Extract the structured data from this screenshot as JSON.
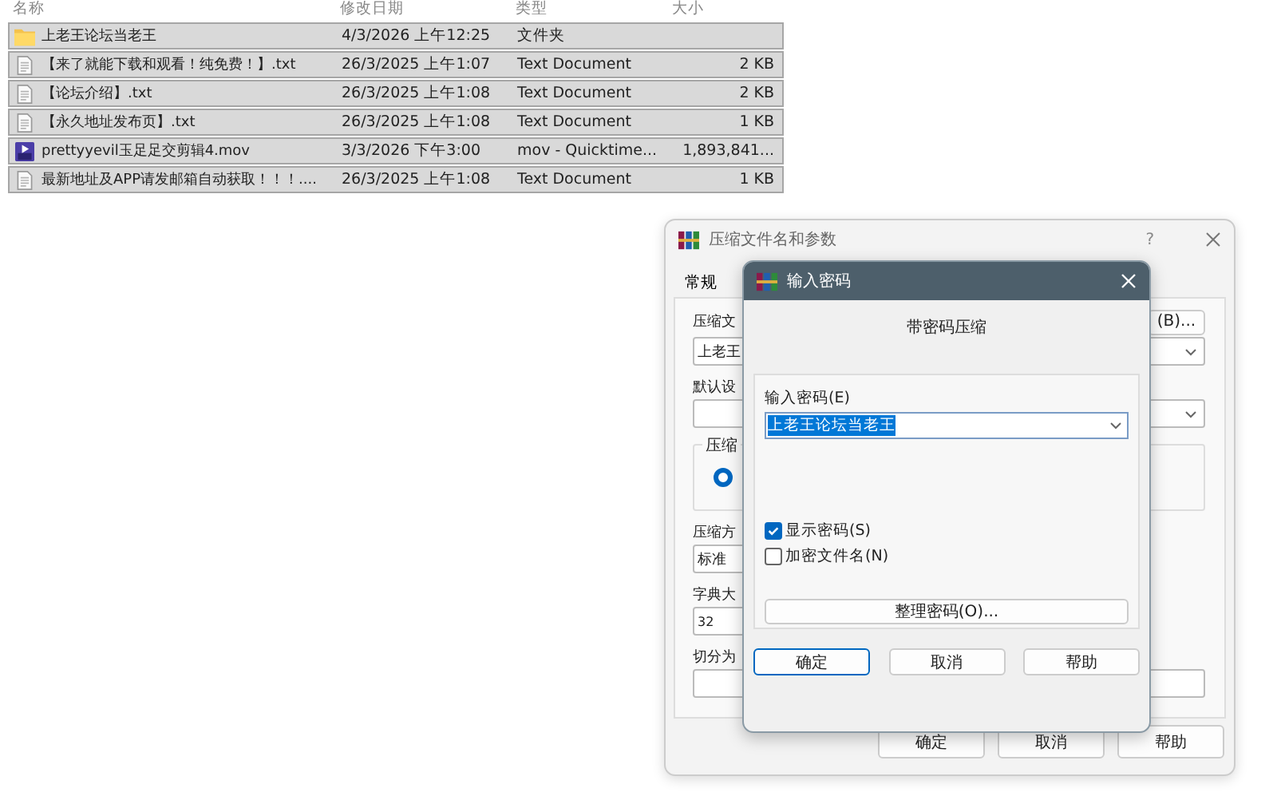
{
  "file_list": {
    "columns": [
      "名称",
      "修改日期",
      "类型",
      "大小"
    ],
    "rows": [
      {
        "kind": "folder",
        "name": "上老王论坛当老王",
        "modified": "4/3/2026 上午12:25",
        "type": "文件夹",
        "size": "",
        "selected": true
      },
      {
        "kind": "text",
        "name": "【来了就能下载和观看！纯免费！】.txt",
        "modified": "26/3/2025 上午1:07",
        "type": "Text Document",
        "size": "2 KB",
        "selected": true
      },
      {
        "kind": "text",
        "name": "【论坛介绍】.txt",
        "modified": "26/3/2025 上午1:08",
        "type": "Text Document",
        "size": "2 KB",
        "selected": true
      },
      {
        "kind": "text",
        "name": "【永久地址发布页】.txt",
        "modified": "26/3/2025 上午1:08",
        "type": "Text Document",
        "size": "1 KB",
        "selected": true
      },
      {
        "kind": "video",
        "name": "prettyyevil玉足足交剪辑4.mov",
        "modified": "3/3/2026 下午3:00",
        "type": "mov - Quicktime...",
        "size": "1,893,841...",
        "selected": true
      },
      {
        "kind": "text",
        "name": "最新地址及APP请发邮箱自动获取！！！....",
        "modified": "26/3/2025 上午1:08",
        "type": "Text Document",
        "size": "1 KB",
        "selected": true
      }
    ]
  },
  "archive_dialog": {
    "title": "压缩文件名和参数",
    "help": "?",
    "tabs": [
      {
        "label": "常规",
        "selected": true
      }
    ],
    "archive_label": "压缩文",
    "browse_button": "(B)...",
    "archive_name": "上老王",
    "profile_label": "默认设",
    "group_label": "压缩",
    "radio_selected": true,
    "method_label": "压缩方",
    "method_value": "标准",
    "dict_label": "字典大",
    "dict_value": "32",
    "split_label": "切分为",
    "buttons": [
      "确定",
      "取消",
      "帮助"
    ]
  },
  "password_dialog": {
    "title": "输入密码",
    "heading": "带密码压缩",
    "password_label": "输入密码(E)",
    "password": "上老王论坛当老王",
    "password_selected": true,
    "options": [
      {
        "label": "显示密码(S)",
        "checked": true
      },
      {
        "label": "加密文件名(N)",
        "checked": false
      }
    ],
    "organize_button": "整理密码(O)...",
    "buttons": [
      {
        "label": "确定",
        "default": true
      },
      {
        "label": "取消",
        "default": false
      },
      {
        "label": "帮助",
        "default": false
      }
    ]
  }
}
